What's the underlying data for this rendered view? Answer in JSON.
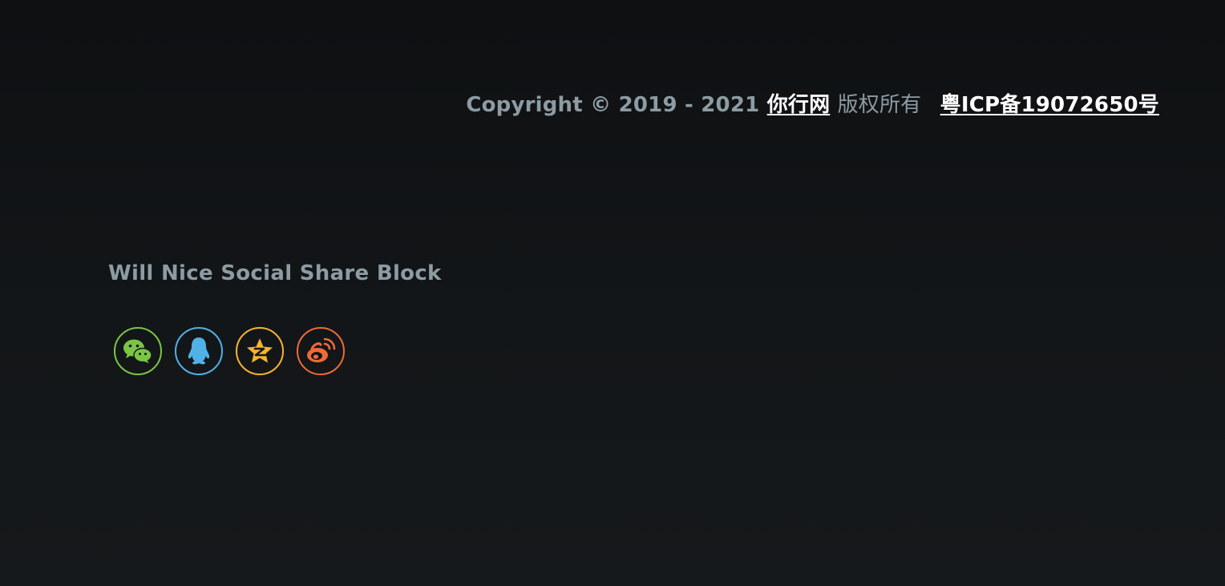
{
  "footer": {
    "copyright_prefix": "Copyright © 2019 - 2021",
    "site_link": "你行网",
    "rights_text": "版权所有",
    "icp_link": "粤ICP备19072650号"
  },
  "share_block": {
    "title": "Will Nice Social Share Block",
    "buttons": [
      {
        "name": "wechat",
        "icon": "wechat-icon",
        "color": "#7bc545"
      },
      {
        "name": "qq",
        "icon": "qq-penguin-icon",
        "color": "#4fb1e6"
      },
      {
        "name": "qzone",
        "icon": "qzone-star-icon",
        "color": "#f7b42c"
      },
      {
        "name": "weibo",
        "icon": "weibo-icon",
        "color": "#ef6a37"
      }
    ]
  }
}
